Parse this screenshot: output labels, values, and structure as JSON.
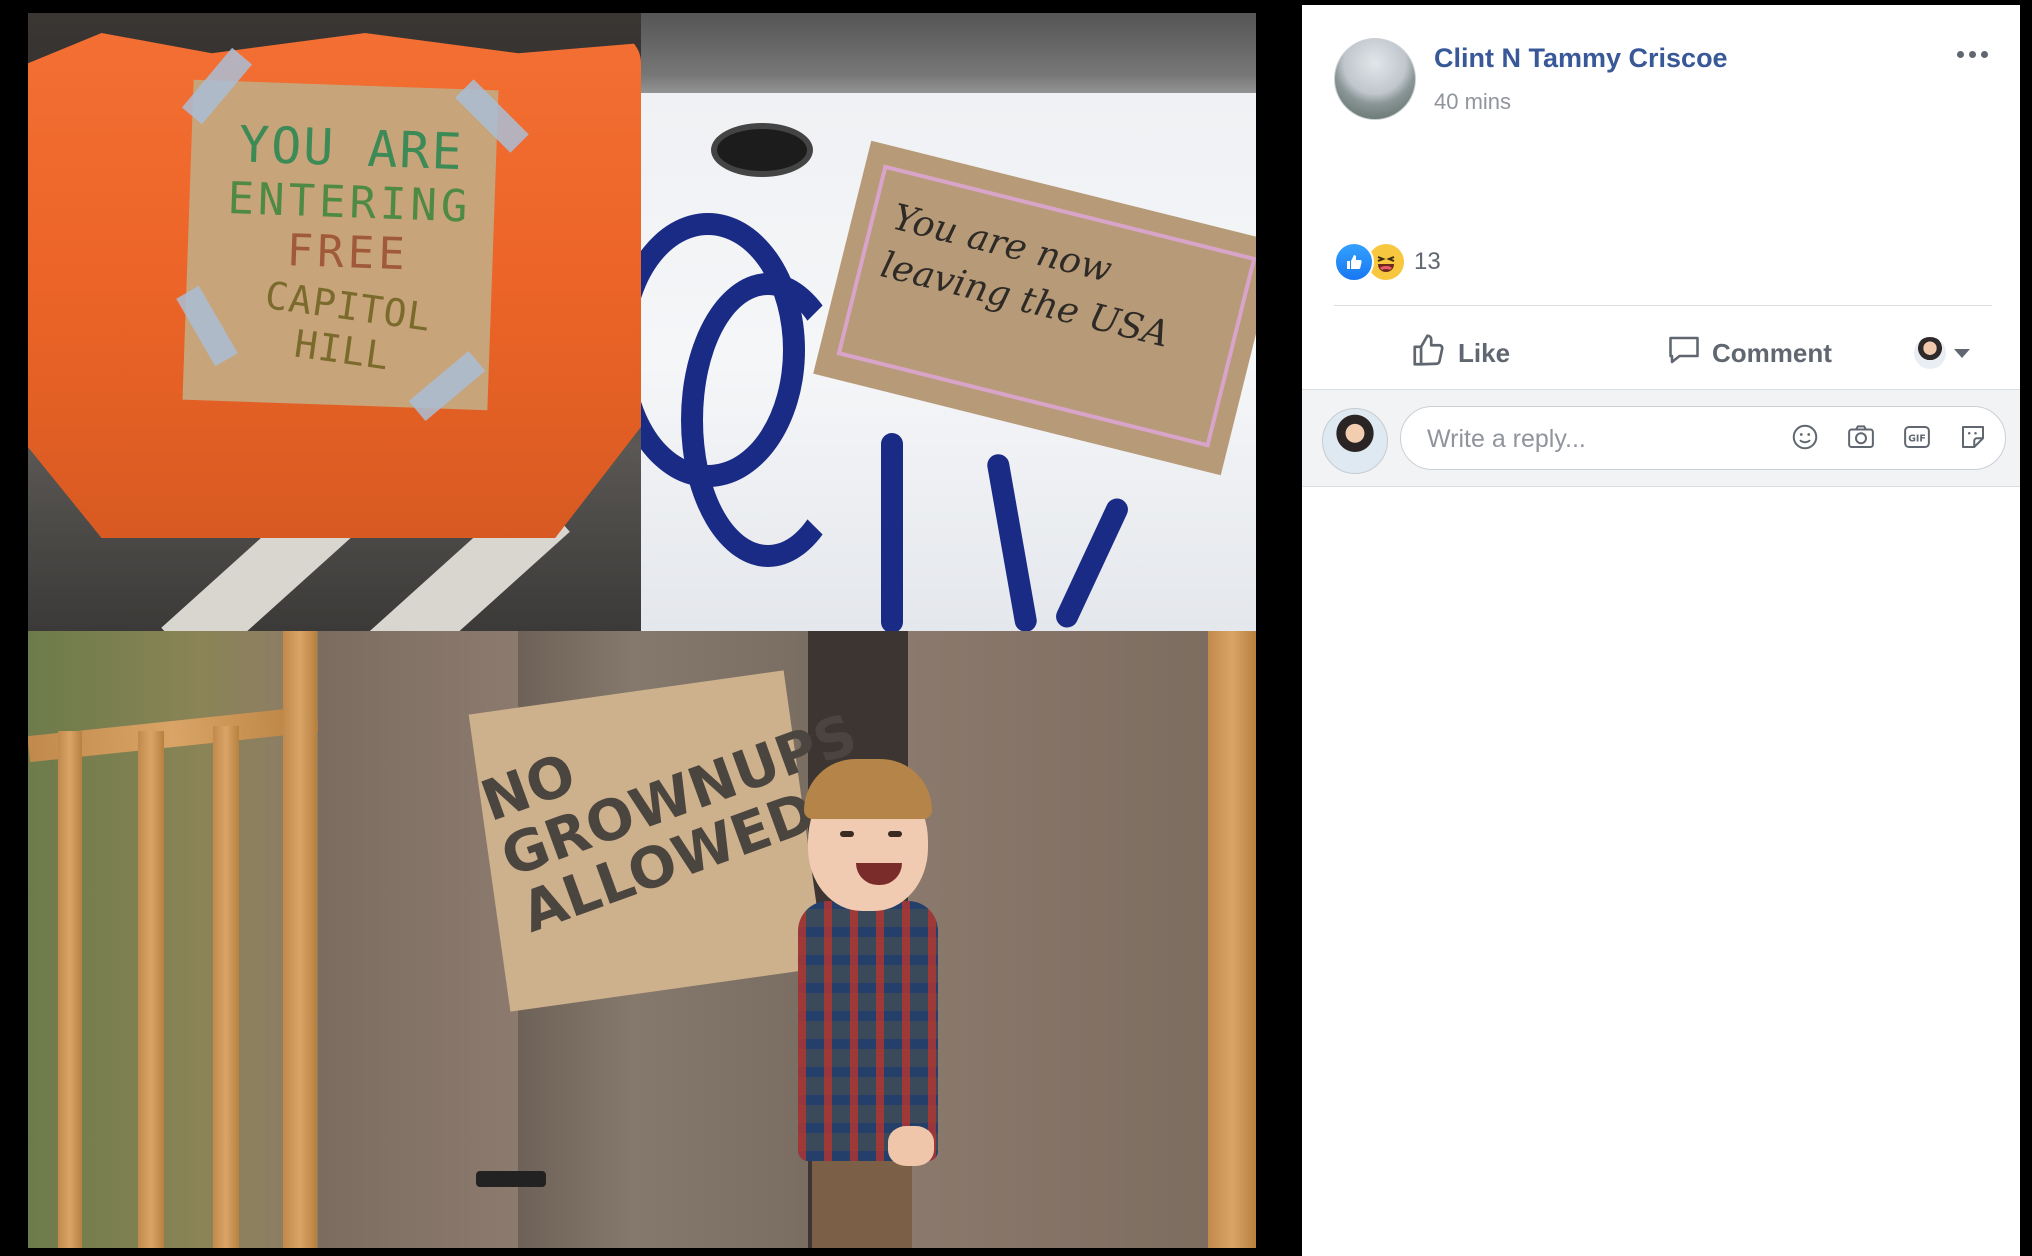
{
  "image_panels": {
    "top_left_sign": [
      "YOU ARE",
      "ENTERING",
      "FREE",
      "CAPITOL HILL"
    ],
    "top_right_sign": [
      "You are now",
      "leaving the USA"
    ],
    "bottom_sign": [
      "NO",
      "GROWNUPS",
      "ALLOWED!"
    ]
  },
  "post": {
    "author": "Clint N Tammy Criscoe",
    "timestamp": "40 mins",
    "more_label": "More options",
    "reactions": {
      "types": [
        "like",
        "haha"
      ],
      "count": "13"
    },
    "actions": {
      "like": "Like",
      "comment": "Comment"
    },
    "reply": {
      "placeholder": "Write a reply..."
    }
  },
  "icons": {
    "more": "more-horizontal-icon",
    "like": "thumbs-up-icon",
    "comment": "comment-bubble-icon",
    "audience_caret": "caret-down-icon",
    "emoji": "emoji-icon",
    "camera": "camera-icon",
    "gif": "gif-icon",
    "sticker": "sticker-icon"
  },
  "colors": {
    "author_link": "#385898",
    "secondary_text": "#90949c",
    "action_text": "#606770",
    "like_blue": "#1877f2",
    "haha_yellow": "#f7c83f",
    "reply_bar_bg": "#f2f3f5"
  }
}
